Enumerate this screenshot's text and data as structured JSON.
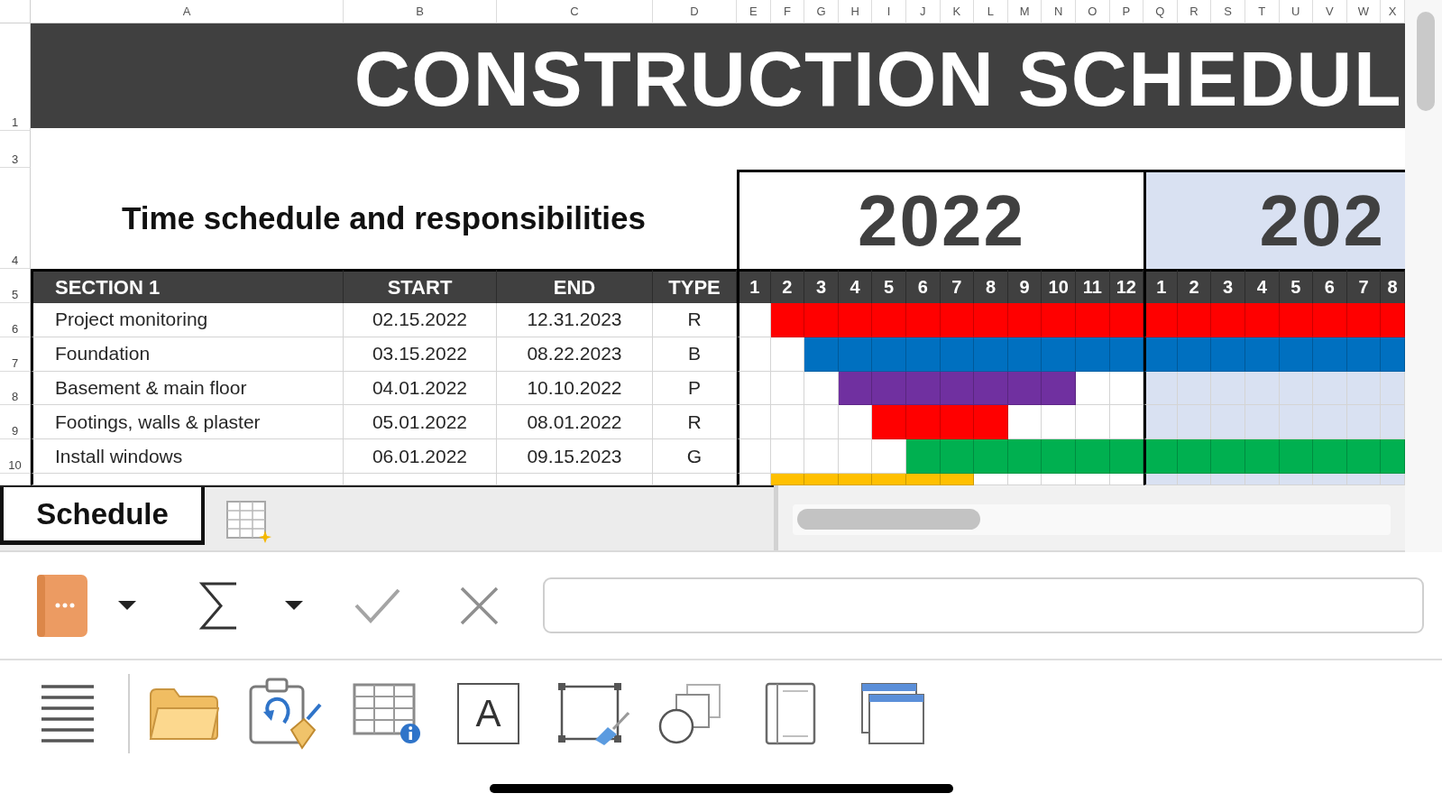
{
  "sheet": {
    "column_headers": [
      "A",
      "B",
      "C",
      "D",
      "E",
      "F",
      "G",
      "H",
      "I",
      "J",
      "K",
      "L",
      "M",
      "N",
      "O",
      "P",
      "Q",
      "R",
      "S",
      "T",
      "U",
      "V",
      "W",
      "X"
    ],
    "title_row": {
      "row": "1",
      "text": "CONSTRUCTION SCHEDUL"
    },
    "blank_row": {
      "row": "3"
    },
    "heading_row": {
      "row": "4",
      "text": "Time schedule and responsibilities"
    },
    "years": [
      {
        "label": "2022",
        "color": "#ffffff",
        "months": [
          "1",
          "2",
          "3",
          "4",
          "5",
          "6",
          "7",
          "8",
          "9",
          "10",
          "11",
          "12"
        ]
      },
      {
        "label": "202",
        "color": "#d9e1f2",
        "months": [
          "1",
          "2",
          "3",
          "4",
          "5",
          "6",
          "7",
          "8"
        ]
      }
    ],
    "header_row": {
      "row": "5",
      "columns": [
        "SECTION 1",
        "START",
        "END",
        "TYPE"
      ]
    },
    "rows": [
      {
        "row": "6",
        "task": "Project monitoring",
        "start": "02.15.2022",
        "end": "12.31.2023",
        "type": "R",
        "color": "#ff0000",
        "months": [
          false,
          true,
          true,
          true,
          true,
          true,
          true,
          true,
          true,
          true,
          true,
          true,
          true,
          true,
          true,
          true,
          true,
          true,
          true,
          true
        ]
      },
      {
        "row": "7",
        "task": "Foundation",
        "start": "03.15.2022",
        "end": "08.22.2023",
        "type": "B",
        "color": "#0070c0",
        "months": [
          false,
          false,
          true,
          true,
          true,
          true,
          true,
          true,
          true,
          true,
          true,
          true,
          true,
          true,
          true,
          true,
          true,
          true,
          true,
          true
        ]
      },
      {
        "row": "8",
        "task": "Basement & main floor",
        "start": "04.01.2022",
        "end": "10.10.2022",
        "type": "P",
        "color": "#7030a0",
        "months": [
          false,
          false,
          false,
          true,
          true,
          true,
          true,
          true,
          true,
          true,
          false,
          false,
          false,
          false,
          false,
          false,
          false,
          false,
          false,
          false
        ]
      },
      {
        "row": "9",
        "task": "Footings, walls & plaster",
        "start": "05.01.2022",
        "end": "08.01.2022",
        "type": "R",
        "color": "#ff0000",
        "months": [
          false,
          false,
          false,
          false,
          true,
          true,
          true,
          true,
          false,
          false,
          false,
          false,
          false,
          false,
          false,
          false,
          false,
          false,
          false,
          false
        ]
      },
      {
        "row": "10",
        "task": "Install windows",
        "start": "06.01.2022",
        "end": "09.15.2023",
        "type": "G",
        "color": "#00b050",
        "months": [
          false,
          false,
          false,
          false,
          false,
          true,
          true,
          true,
          true,
          true,
          true,
          true,
          true,
          true,
          true,
          true,
          true,
          true,
          true,
          true
        ]
      },
      {
        "color": "#ffc000",
        "months": [
          false,
          true,
          true,
          true,
          true,
          true,
          true,
          false,
          false,
          false,
          false,
          false,
          false,
          false,
          false,
          false,
          false,
          false,
          false,
          false
        ]
      }
    ]
  },
  "sheet_tabs": [
    {
      "label": "Schedule",
      "selected": true
    }
  ],
  "toolbar": {
    "text_box_label": "A"
  }
}
